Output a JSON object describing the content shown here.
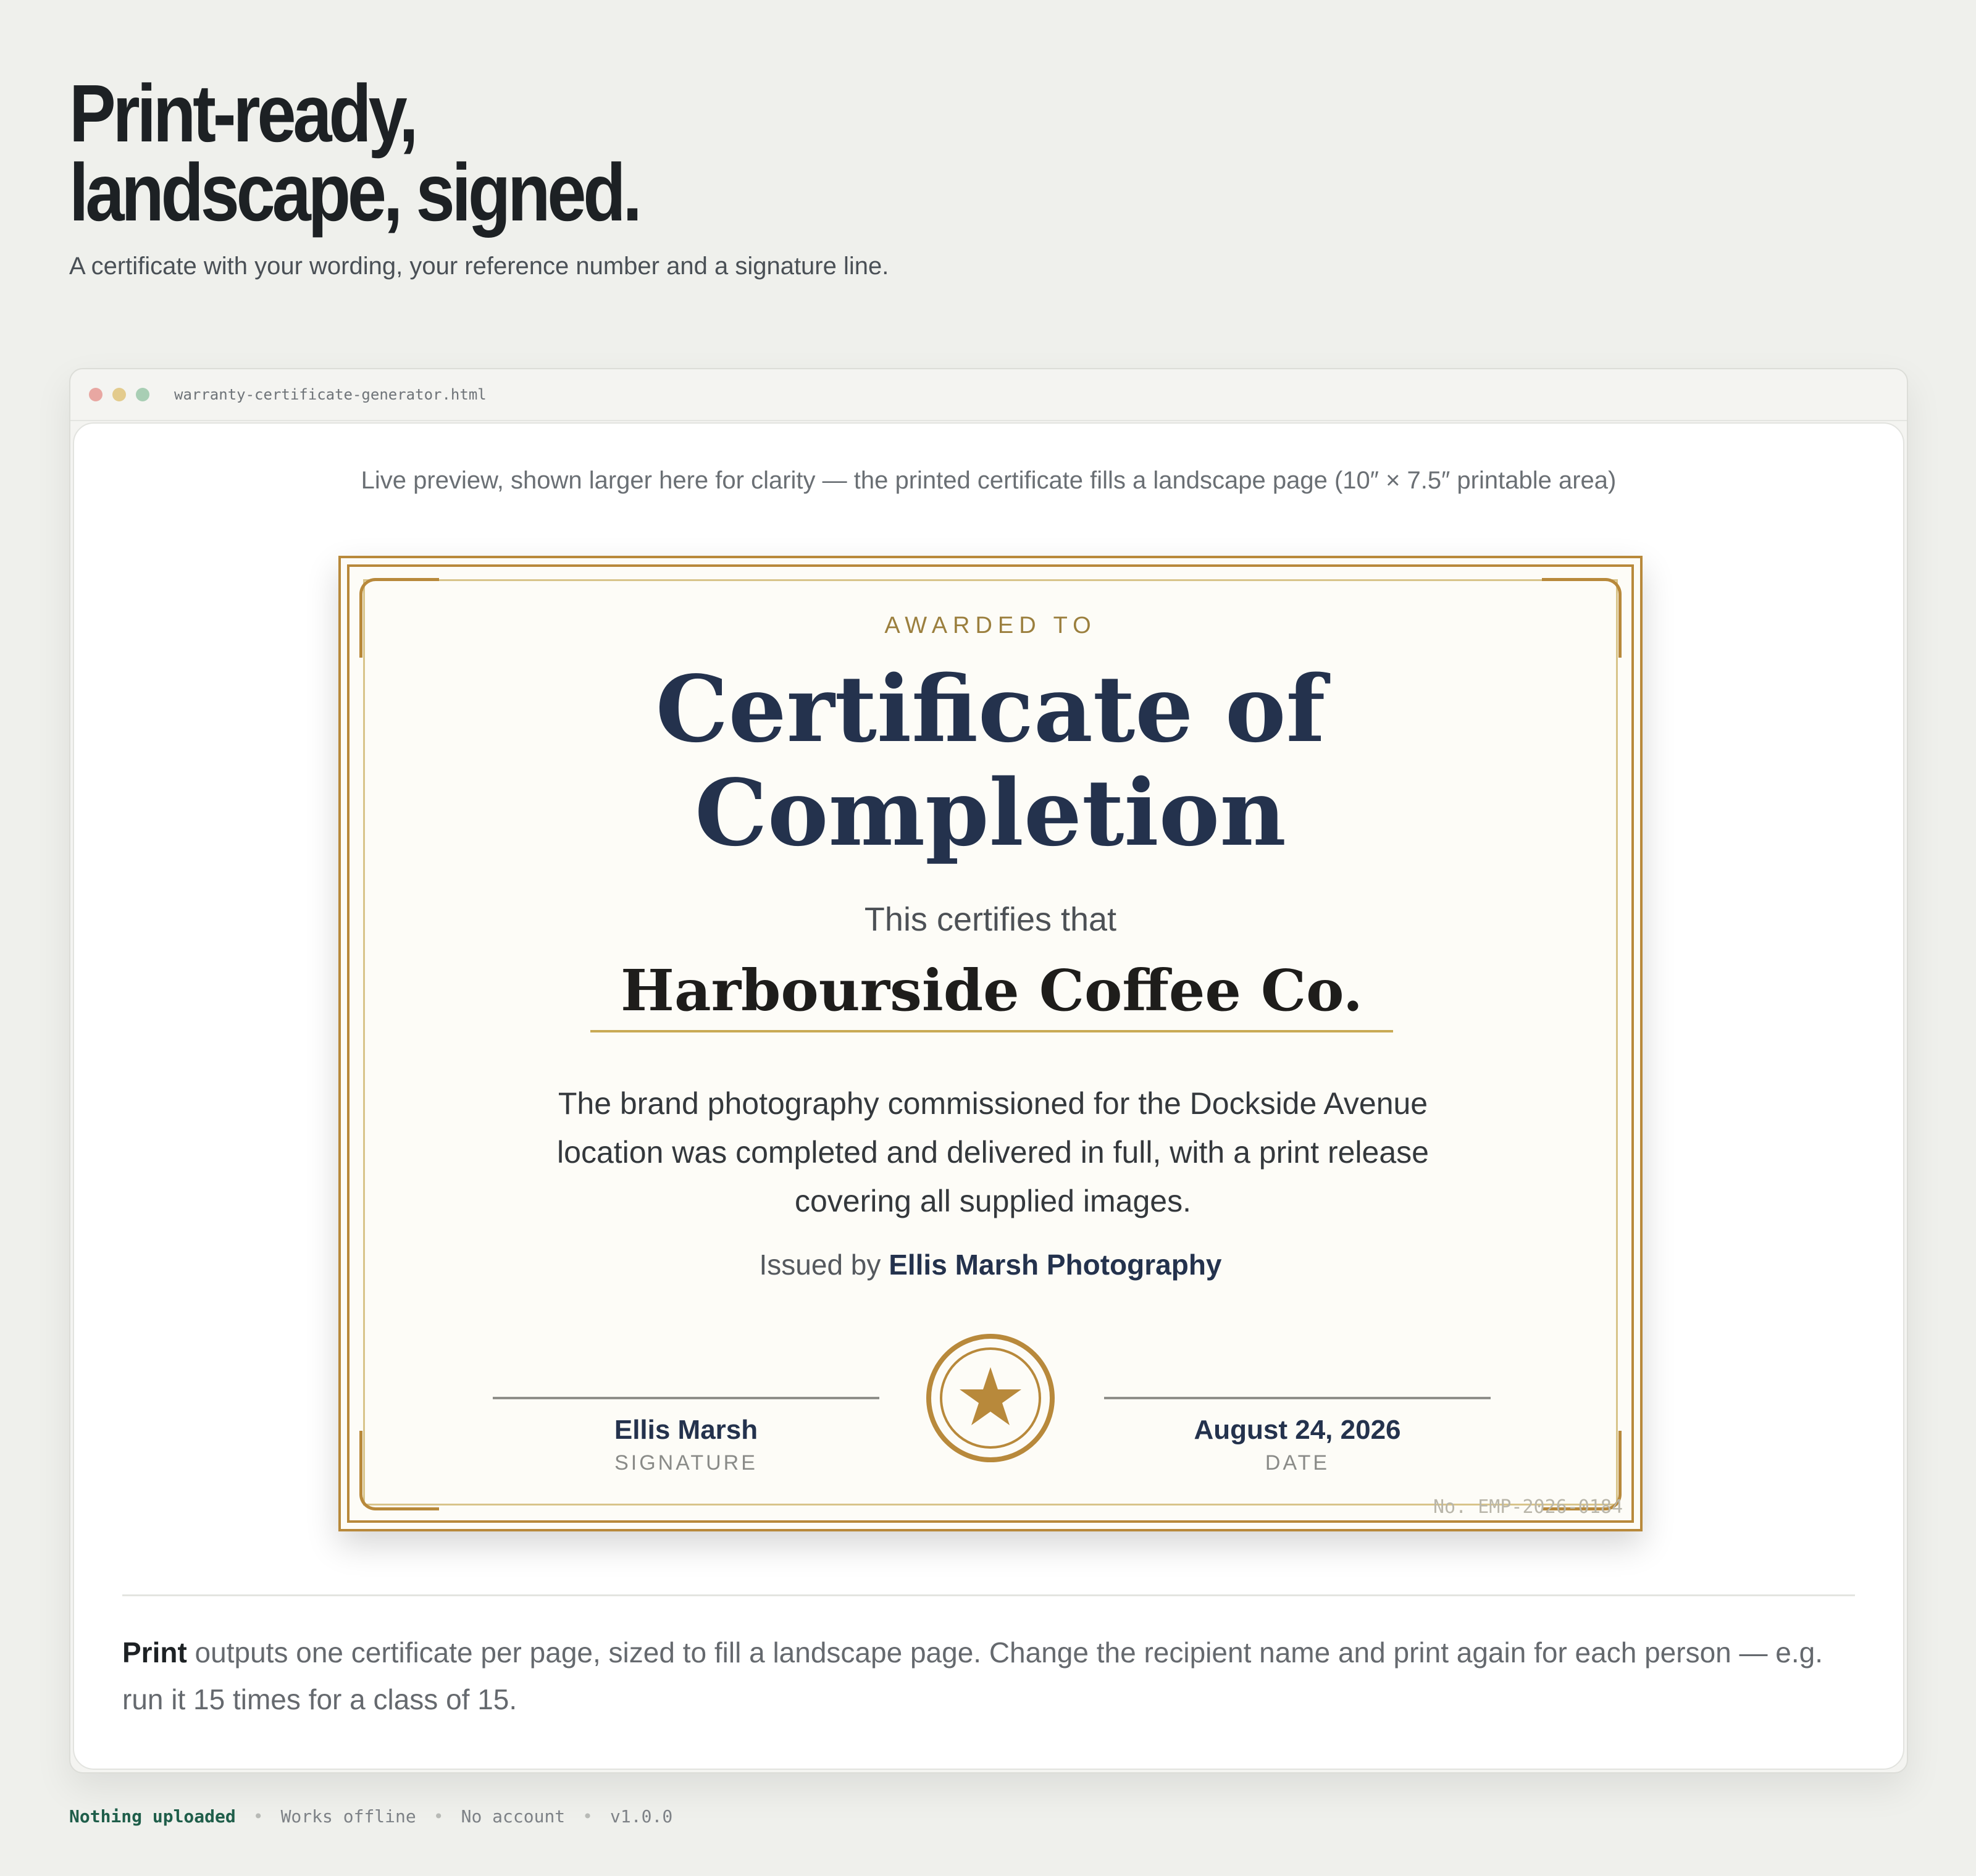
{
  "hero": {
    "title_line1": "Print-ready,",
    "title_line2": "landscape, signed.",
    "subtitle": "A certificate with your wording, your reference number and a signature line."
  },
  "window": {
    "filename": "warranty-certificate-generator.html",
    "preview_note": "Live preview, shown larger here for clarity — the printed certificate fills a landscape page (10″ × 7.5″ printable area)"
  },
  "certificate": {
    "awarded_to": "AWARDED TO",
    "title_line1": "Certificate of",
    "title_line2": "Completion",
    "certifies": "This certifies that",
    "recipient": "Harbourside Coffee Co.",
    "body": "The brand photography commissioned for the Dockside Avenue location was completed and delivered in full, with a print release covering all supplied images.",
    "issued_prefix": "Issued by",
    "issuer": "Ellis Marsh Photography",
    "signature_name": "Ellis Marsh",
    "signature_caption": "SIGNATURE",
    "date_value": "August 24, 2026",
    "date_caption": "DATE",
    "reference_number": "No. EMP-2026-0184",
    "seal_icon": "star-seal-icon",
    "colors": {
      "gold": "#b8893b",
      "navy": "#24324d"
    }
  },
  "print_note": {
    "bold": "Print",
    "text": " outputs one certificate per page, sized to fill a landscape page. Change the recipient name and print again for each person — e.g. run it 15 times for a class of 15."
  },
  "footer": {
    "items": [
      "Nothing uploaded",
      "Works offline",
      "No account",
      "v1.0.0"
    ]
  }
}
